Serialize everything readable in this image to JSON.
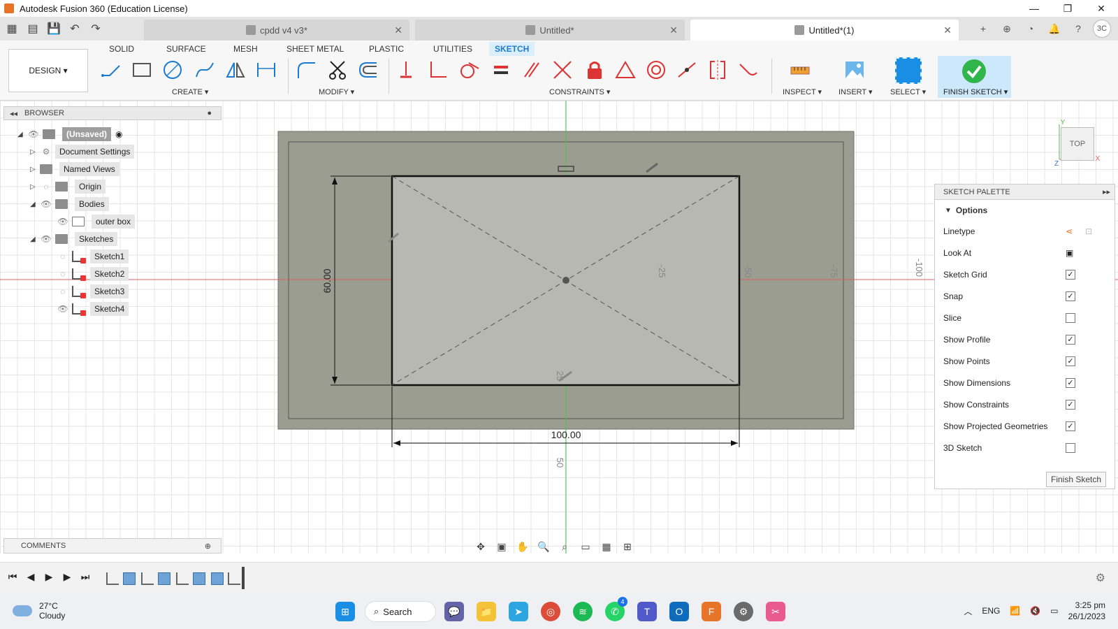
{
  "window": {
    "title": "Autodesk Fusion 360 (Education License)"
  },
  "tabs": [
    {
      "label": "cpdd v4 v3*",
      "active": false
    },
    {
      "label": "Untitled*",
      "active": false
    },
    {
      "label": "Untitled*(1)",
      "active": true
    }
  ],
  "user_initials": "3C",
  "ribbon": {
    "workspace": "DESIGN ▾",
    "tabs": [
      "SOLID",
      "SURFACE",
      "MESH",
      "SHEET METAL",
      "PLASTIC",
      "UTILITIES",
      "SKETCH"
    ],
    "active_tab": "SKETCH",
    "groups": {
      "create": "CREATE ▾",
      "modify": "MODIFY ▾",
      "constraints": "CONSTRAINTS ▾",
      "inspect": "INSPECT ▾",
      "insert": "INSERT ▾",
      "select": "SELECT ▾",
      "finish": "FINISH SKETCH ▾"
    }
  },
  "browser": {
    "title": "BROWSER",
    "items": [
      {
        "label": "(Unsaved)"
      },
      {
        "label": "Document Settings"
      },
      {
        "label": "Named Views"
      },
      {
        "label": "Origin"
      },
      {
        "label": "Bodies"
      },
      {
        "label": "outer box"
      },
      {
        "label": "Sketches"
      },
      {
        "label": "Sketch1"
      },
      {
        "label": "Sketch2"
      },
      {
        "label": "Sketch3"
      },
      {
        "label": "Sketch4"
      }
    ]
  },
  "comments": {
    "title": "COMMENTS"
  },
  "canvas": {
    "dim_height": "60.00",
    "dim_width": "100.00",
    "axis_labels": [
      "-25",
      "-50",
      "-75",
      "-100",
      "25",
      "50"
    ],
    "viewcube": "TOP",
    "axes": {
      "x": "X",
      "y": "Y",
      "z": "Z"
    }
  },
  "palette": {
    "title": "SKETCH PALETTE",
    "section": "Options",
    "rows": [
      {
        "label": "Linetype",
        "type": "icon"
      },
      {
        "label": "Look At",
        "type": "icon"
      },
      {
        "label": "Sketch Grid",
        "checked": true
      },
      {
        "label": "Snap",
        "checked": true
      },
      {
        "label": "Slice",
        "checked": false
      },
      {
        "label": "Show Profile",
        "checked": true
      },
      {
        "label": "Show Points",
        "checked": true
      },
      {
        "label": "Show Dimensions",
        "checked": true
      },
      {
        "label": "Show Constraints",
        "checked": true
      },
      {
        "label": "Show Projected Geometries",
        "checked": true
      },
      {
        "label": "3D Sketch",
        "checked": false
      }
    ],
    "finish_button": "Finish Sketch"
  },
  "taskbar": {
    "weather_temp": "27°C",
    "weather_desc": "Cloudy",
    "search": "Search",
    "lang": "ENG",
    "time": "3:25 pm",
    "date": "26/1/2023",
    "teams_badge": "4"
  },
  "colors": {
    "accent": "#1b7bd0",
    "sketch_body": "#9a9d8f",
    "profile_fill": "#b7b8b1",
    "finish_green": "#2fb54a",
    "x_axis": "#e06060",
    "y_axis": "#4cc24c"
  }
}
